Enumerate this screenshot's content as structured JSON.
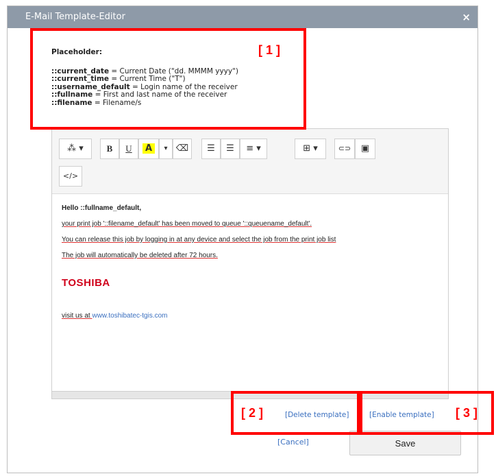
{
  "dialog": {
    "title": "E-Mail Template-Editor",
    "close_icon": "×"
  },
  "placeholder": {
    "heading": "Placeholder:",
    "items": [
      {
        "key": "::current_date",
        "desc": " = Current Date (\"dd. MMMM yyyy\")"
      },
      {
        "key": "::current_time",
        "desc": " = Current Time (\"T\")"
      },
      {
        "key": "::username_default",
        "desc": " = Login name of the receiver"
      },
      {
        "key": "::fullname",
        "desc": " = First and last name of the receiver"
      },
      {
        "key": "::filename",
        "desc": " = Filename/s"
      }
    ]
  },
  "toolbar": {
    "magic": "⁂ ▾",
    "bold": "B",
    "underline": "U",
    "fontcolor": "A",
    "fontcolor_caret": "▾",
    "eraser": "⌫",
    "ul": "☰",
    "ol": "☰",
    "align": "≡ ▾",
    "table": "⊞ ▾",
    "link": "⊂⊃",
    "image": "▣",
    "code": "</>"
  },
  "content": {
    "hello": "Hello ::fullname_default,",
    "line1": "your print job '::filename_default' has been moved to queue '::queuename_default'.",
    "line2": "You can release this job by logging in at any device and select the job from the print job list",
    "line3": "The job will automatically be deleted after 72 hours.",
    "logo": "TOSHIBA",
    "visit_prefix": "visit us at ",
    "visit_link": "www.toshibatec-tgis.com"
  },
  "actions": {
    "delete": "[Delete template]",
    "enable": "[Enable template]",
    "cancel": "[Cancel]",
    "save": "Save"
  },
  "annotations": {
    "a1": "[ 1 ]",
    "a2": "[ 2 ]",
    "a3": "[ 3 ]",
    "color": "#ff0000"
  }
}
